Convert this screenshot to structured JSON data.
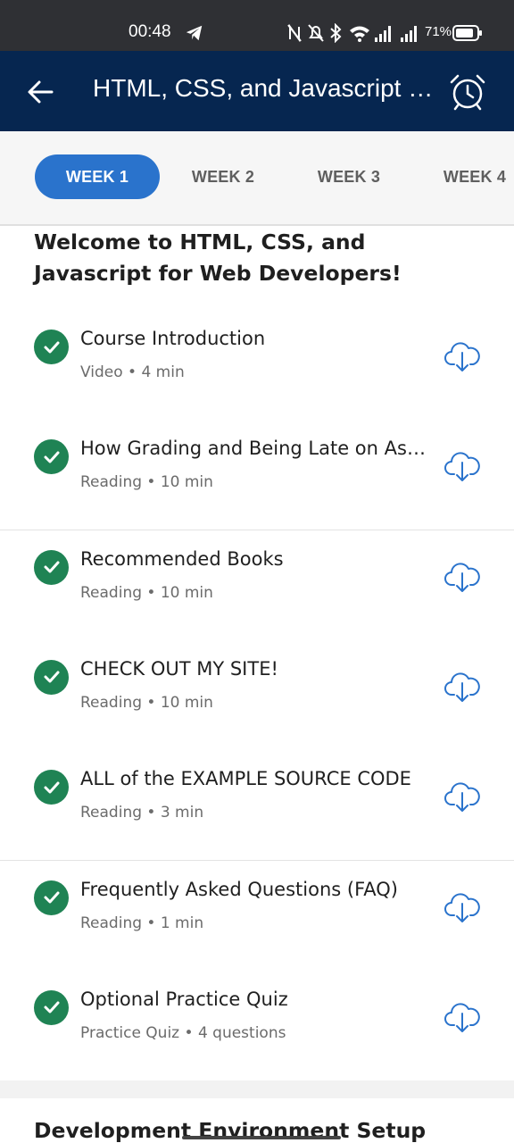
{
  "status_bar": {
    "time": "00:48",
    "battery": "71%",
    "icons": [
      "telegram-icon",
      "nfc-icon",
      "bell-off-icon",
      "bluetooth-icon",
      "wifi-icon",
      "signal-icon",
      "signal-icon",
      "battery-icon"
    ]
  },
  "app_bar": {
    "title": "HTML, CSS, and Javascript for Web Developers",
    "background": "#062650"
  },
  "tabs": [
    {
      "label": "WEEK 1",
      "active": true
    },
    {
      "label": "WEEK 2",
      "active": false
    },
    {
      "label": "WEEK 3",
      "active": false
    },
    {
      "label": "WEEK 4",
      "active": false
    }
  ],
  "section": {
    "title": "Welcome to HTML, CSS, and Javascript for Web Developers!",
    "items": [
      {
        "title": "Course Introduction",
        "meta": "Video • 4 min",
        "completed": true
      },
      {
        "title": "How Grading and Being Late on Assignments Works",
        "meta": "Reading • 10 min",
        "completed": true
      },
      {
        "title": "Recommended Books",
        "meta": "Reading • 10 min",
        "completed": true
      },
      {
        "title": "CHECK OUT MY SITE!",
        "meta": "Reading • 10 min",
        "completed": true
      },
      {
        "title": "ALL of the EXAMPLE SOURCE CODE",
        "meta": "Reading • 3 min",
        "completed": true
      },
      {
        "title": "Frequently Asked Questions (FAQ)",
        "meta": "Reading • 1 min",
        "completed": true
      },
      {
        "title": "Optional Practice Quiz",
        "meta": "Practice Quiz • 4 questions",
        "completed": true
      }
    ]
  },
  "next_section": {
    "title": "Development Environment Setup"
  },
  "colors": {
    "accent": "#2a73cc",
    "complete": "#1f8354",
    "download": "#2a73cc"
  }
}
